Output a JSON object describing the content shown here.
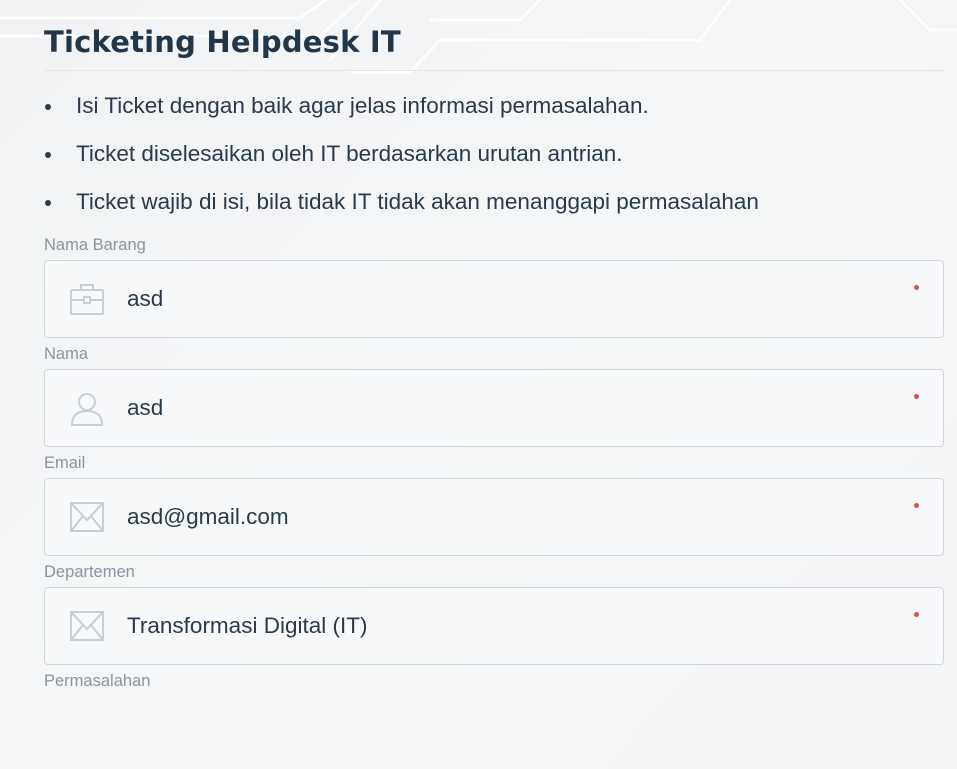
{
  "header": {
    "title": "Ticketing Helpdesk IT"
  },
  "rules": [
    "Isi Ticket dengan baik agar jelas informasi permasalahan.",
    "Ticket diselesaikan oleh IT berdasarkan urutan antrian.",
    "Ticket wajib di isi, bila tidak IT tidak akan menanggapi permasalahan"
  ],
  "form": {
    "nama_barang": {
      "label": "Nama Barang",
      "value": "asd",
      "icon": "briefcase-icon",
      "required": true
    },
    "nama": {
      "label": "Nama",
      "value": "asd",
      "icon": "user-icon",
      "required": true
    },
    "email": {
      "label": "Email",
      "value": "asd@gmail.com",
      "icon": "envelope-icon",
      "required": true
    },
    "departemen": {
      "label": "Departemen",
      "value": "Transformasi Digital (IT)",
      "icon": "envelope-icon",
      "required": true
    },
    "permasalahan": {
      "label": "Permasalahan"
    }
  },
  "colors": {
    "title": "#22364a",
    "text": "#2b3a4a",
    "label": "#8a95a0",
    "border": "#d3d6d9",
    "required_dot": "#d9534f"
  }
}
